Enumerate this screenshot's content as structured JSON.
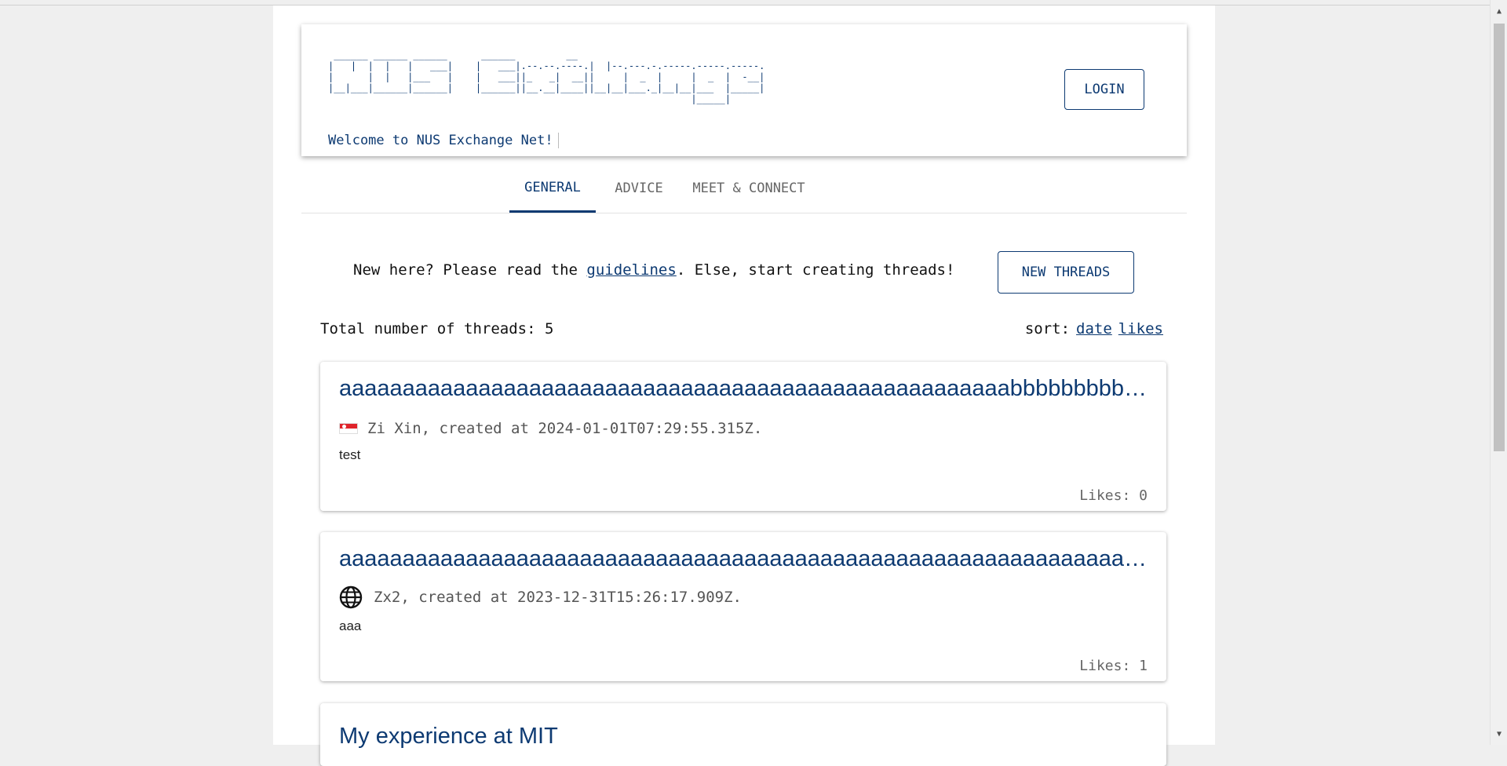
{
  "header": {
    "logo_ascii": " ______ ______ ______      ______         __\n|   |  |  |   |   ___|    |   ___|.--.--.----.|  |--.---.-.-----.-----.-----.\n|      |  |   |___   |    |   ___||_   _|  __||     |  _  |     |  _  |  -__|\n|__|___|______|______|    |______||__.__|____||__|__|___._|__|__|___  |_____|\n                                                                |_____|",
    "welcome": "Welcome to NUS Exchange Net!",
    "login_label": "LOGIN"
  },
  "tabs": [
    {
      "label": "GENERAL"
    },
    {
      "label": "ADVICE"
    },
    {
      "label": "MEET & CONNECT"
    }
  ],
  "intro": {
    "before": "New here? Please read the ",
    "link": "guidelines",
    "after": ". Else, start creating threads!",
    "new_threads_label": "NEW THREADS"
  },
  "threads_info": {
    "count_text": "Total number of threads: 5",
    "sort_label": "sort:",
    "sort_date": "date",
    "sort_likes": "likes"
  },
  "threads": [
    {
      "title": "aaaaaaaaaaaaaaaaaaaaaaaaaaaaaaaaaaaaaaaaaaaaaaaaaaaaabbbbbbbbbbbbbbbbbbbbbbbbbbbbbbbbbbbbbbbbbbbbbbbbbbbbbbbbbbbbbbbbbbbbbbbbbbbbbbbb",
      "meta": "Zi Xin, created at 2024-01-01T07:29:55.315Z.",
      "icon": "singapore-flag-icon",
      "body": "test",
      "likes": "Likes: 0"
    },
    {
      "title": "aaaaaaaaaaaaaaaaaaaaaaaaaaaaaaaaaaaaaaaaaaaaaaaaaaaaaaaaaaaaaaaaaaaaaaaaaaaaaaaaaaaaaaaaaaaaaaaaaaaaaaaaaaaaaaaaaaaaaaaaaaaaaaaaaaaaaaa",
      "meta": "Zx2, created at 2023-12-31T15:26:17.909Z.",
      "icon": "globe-icon",
      "body": "aaa",
      "likes": "Likes: 1"
    },
    {
      "title": "My experience at MIT"
    }
  ],
  "colors": {
    "brand": "#0d3a72",
    "page_bg": "#efefef",
    "card_bg": "#ffffff"
  }
}
